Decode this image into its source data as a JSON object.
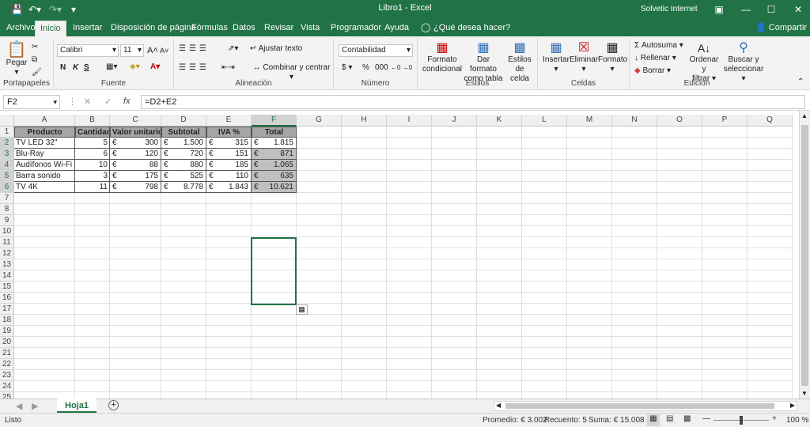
{
  "titlebar": {
    "title": "Libro1  -  Excel",
    "user": "Solvetic Internet"
  },
  "tabs": [
    {
      "label": "Archivo"
    },
    {
      "label": "Inicio"
    },
    {
      "label": "Insertar"
    },
    {
      "label": "Disposición de página"
    },
    {
      "label": "Fórmulas"
    },
    {
      "label": "Datos"
    },
    {
      "label": "Revisar"
    },
    {
      "label": "Vista"
    },
    {
      "label": "Programador"
    },
    {
      "label": "Ayuda"
    },
    {
      "label": "¿Qué desea hacer?"
    }
  ],
  "share": "Compartir",
  "ribbon": {
    "clipboard": {
      "paste": "Pegar",
      "label": "Portapapeles"
    },
    "font": {
      "name": "Calibri",
      "size": "11",
      "label": "Fuente",
      "bold": "N",
      "italic": "K",
      "underline": "S"
    },
    "alignment": {
      "wrap": "Ajustar texto",
      "merge": "Combinar y centrar",
      "label": "Alineación"
    },
    "number": {
      "format": "Contabilidad",
      "currency": "$",
      "percent": "%",
      "thousands": "000",
      "label": "Número"
    },
    "styles": {
      "conditional1": "Formato",
      "conditional2": "condicional",
      "table1": "Dar formato",
      "table2": "como tabla",
      "cell1": "Estilos de",
      "cell2": "celda",
      "label": "Estilos"
    },
    "cells": {
      "insert": "Insertar",
      "delete": "Eliminar",
      "format": "Formato",
      "label": "Celdas"
    },
    "editing": {
      "autosum": "Autosuma",
      "fill": "Rellenar",
      "clear": "Borrar",
      "sort1": "Ordenar y",
      "sort2": "filtrar",
      "find1": "Buscar y",
      "find2": "seleccionar",
      "label": "Edición"
    }
  },
  "formula_bar": {
    "name_box": "F2",
    "formula": "=D2+E2",
    "fx": "fx"
  },
  "columns": [
    "A",
    "B",
    "C",
    "D",
    "E",
    "F",
    "G",
    "H",
    "I",
    "J",
    "K",
    "L",
    "M",
    "N",
    "O",
    "P",
    "Q"
  ],
  "rows": [
    "1",
    "2",
    "3",
    "4",
    "5",
    "6",
    "7",
    "8",
    "9",
    "10",
    "11",
    "12",
    "13",
    "14",
    "15",
    "16",
    "17",
    "18",
    "19",
    "20",
    "21",
    "22",
    "23",
    "24",
    "25"
  ],
  "table": {
    "headers": [
      "Producto",
      "Cantidad",
      "Valor unitario",
      "Subtotal",
      "IVA %",
      "Total"
    ],
    "currency_symbol": "€",
    "data": [
      {
        "producto": "TV LED 32\"",
        "cantidad": "5",
        "valor": "300",
        "subtotal": "1.500",
        "iva": "315",
        "total": "1.815"
      },
      {
        "producto": "Blu-Ray",
        "cantidad": "6",
        "valor": "120",
        "subtotal": "720",
        "iva": "151",
        "total": "871"
      },
      {
        "producto": "Audífonos Wi-Fi",
        "cantidad": "10",
        "valor": "88",
        "subtotal": "880",
        "iva": "185",
        "total": "1.065"
      },
      {
        "producto": "Barra sonido",
        "cantidad": "3",
        "valor": "175",
        "subtotal": "525",
        "iva": "110",
        "total": "635"
      },
      {
        "producto": "TV 4K",
        "cantidad": "11",
        "valor": "798",
        "subtotal": "8.778",
        "iva": "1.843",
        "total": "10.621"
      }
    ]
  },
  "sheet": {
    "tab": "Hoja1"
  },
  "status": {
    "mode": "Listo",
    "average": "Promedio: € 3.002",
    "count": "Recuento: 5",
    "sum": "Suma: € 15.008",
    "zoom": "100 %"
  },
  "colors": {
    "accent": "#217346",
    "header_fill": "#a6a6a6"
  }
}
